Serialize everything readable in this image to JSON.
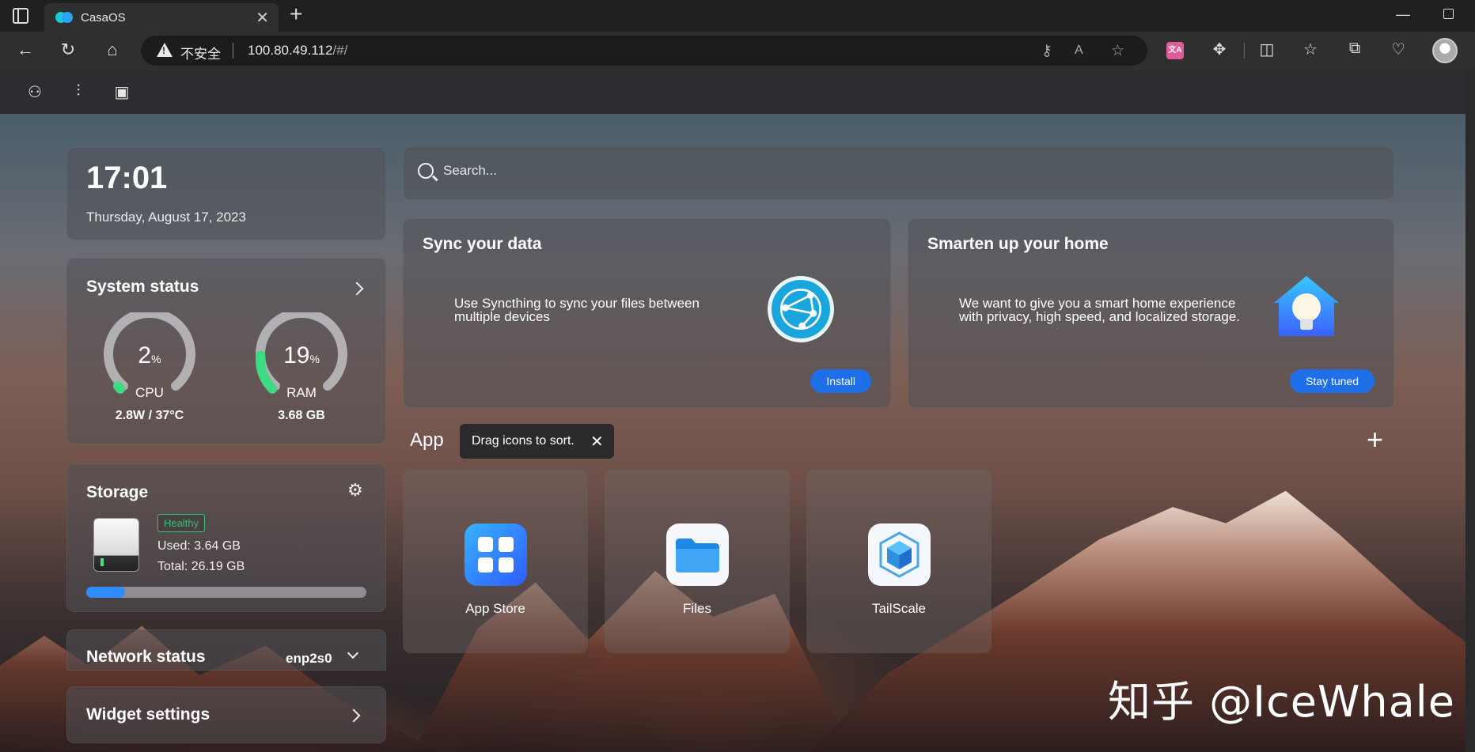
{
  "browser": {
    "tab_title": "CasaOS",
    "insecure_label": "不安全",
    "url_host": "100.80.49.112",
    "url_path": "/#/"
  },
  "clock": {
    "time": "17:01",
    "date": "Thursday, August 17, 2023"
  },
  "system_status": {
    "title": "System status",
    "cpu": {
      "value": "2",
      "unit": "%",
      "percent": 2,
      "label": "CPU",
      "detail": "2.8W / 37°C"
    },
    "ram": {
      "value": "19",
      "unit": "%",
      "percent": 19,
      "label": "RAM",
      "detail": "3.68 GB"
    }
  },
  "storage": {
    "title": "Storage",
    "badge": "Healthy",
    "used": "Used: 3.64 GB",
    "total": "Total: 26.19 GB",
    "used_fraction": 0.139
  },
  "network": {
    "title": "Network status",
    "interface": "enp2s0"
  },
  "widget_settings": {
    "title": "Widget settings"
  },
  "search": {
    "placeholder": "Search..."
  },
  "promos": [
    {
      "title": "Sync your data",
      "desc": "Use Syncthing to sync your files between multiple devices",
      "button": "Install"
    },
    {
      "title": "Smarten up your home",
      "desc": "We want to give you a smart home experience with privacy, high speed, and localized storage.",
      "button": "Stay tuned"
    }
  ],
  "apps_section": {
    "title": "App",
    "tooltip": "Drag icons to sort."
  },
  "apps": [
    {
      "label": "App Store"
    },
    {
      "label": "Files"
    },
    {
      "label": "TailScale"
    }
  ],
  "watermark": "知乎 @IceWhale",
  "colors": {
    "accent": "#1e6fe8",
    "gauge_fill": "#3ddc84",
    "healthy": "#35c27a"
  }
}
